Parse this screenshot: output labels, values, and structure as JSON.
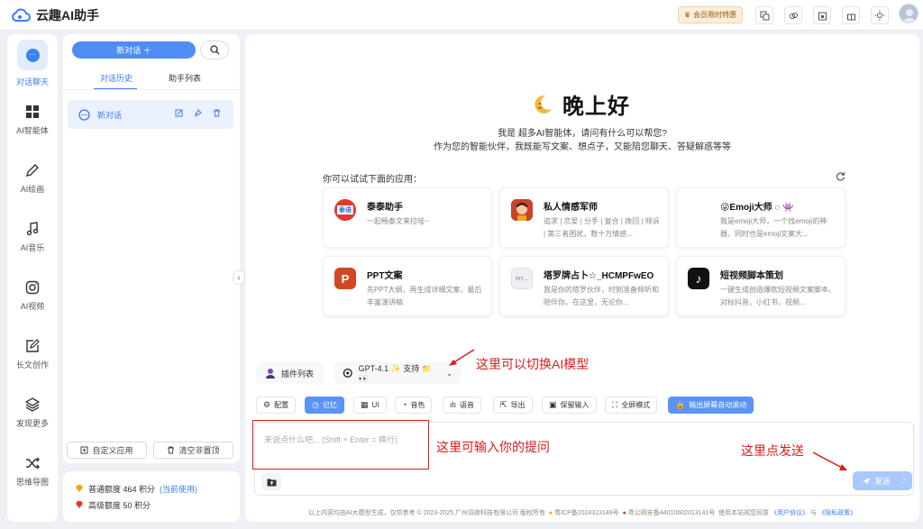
{
  "app": {
    "title": "云趣AI助手",
    "brand_color": "#3b7cf0"
  },
  "topbar": {
    "member_label": "会员限时特惠"
  },
  "rail": [
    {
      "label": "对话聊天"
    },
    {
      "label": "AI智能体"
    },
    {
      "label": "AI绘画"
    },
    {
      "label": "AI音乐"
    },
    {
      "label": "AI视频"
    },
    {
      "label": "长文创作"
    },
    {
      "label": "发现更多"
    },
    {
      "label": "思维导图"
    }
  ],
  "sidebar": {
    "new_chat": "新对话 ＋",
    "tabs": [
      "对话历史",
      "助手列表"
    ],
    "conversations": [
      {
        "title": "新对话"
      }
    ],
    "custom_app": "自定义应用",
    "clear": "清空非置顶"
  },
  "quota": {
    "normal": "普通额度 464 积分",
    "current": "(当前使用)",
    "advanced": "高级额度 50 积分"
  },
  "main": {
    "greeting": "晚上好",
    "intro1": "我是 超多AI智能体，请问有什么可以帮您?",
    "intro2": "作为您的智能伙伴，我既能写文案、想点子，又能陪您聊天、答疑解惑等等",
    "try_label": "你可以试试下面的应用：",
    "apps": [
      {
        "title": "泰泰助手",
        "desc": "一起畅泰文来拉哇~",
        "icon_text": "泰语"
      },
      {
        "title": "私人情感军师",
        "desc": "追求 | 恋爱 | 分手 | 复合 | 挽回 | 倾诉 | 第三者困扰，数十万情感...",
        "icon_text": ""
      },
      {
        "title": "😜Emoji大师 ◌ 👾",
        "desc": "我是emoji大师，一个找emoji的神器，同时也是emoji文案大...",
        "icon_text": "😎"
      },
      {
        "title": "PPT文案",
        "desc": "先PPT大纲，再生成详细文案，最后丰富演讲稿",
        "icon_text": "P"
      },
      {
        "title": "塔罗牌占卜☆_HCMPFwEO",
        "desc": "我是你的塔罗伙伴，时刻准备倾听和陪伴你。在这里，无论你...",
        "icon_text": "err..."
      },
      {
        "title": "短视频脚本策划",
        "desc": "一键生成创造爆款短视频文案脚本。对标抖音，小红书，视频...",
        "icon_text": "♪"
      }
    ],
    "plugin_label": "插件列表",
    "model_label": "GPT-4.1 ✨ 支持 📁 👀",
    "tools": [
      "配置",
      "记忆",
      "UI",
      "音色",
      "语音",
      "导出",
      "保留输入",
      "全屏模式",
      "输出屏幕自动滚动"
    ],
    "input_placeholder": "来说点什么吧... (Shift + Enter = 换行)",
    "send_label": "发送",
    "footer": {
      "text1": "以上内容均由AI大模型生成，仅供参考 © 2023-2025 广州羽夜科技有限公司 版权所有",
      "icp": "粤ICP备2024313148号",
      "gongan": "粤公网安备44010602013141号",
      "text2": "使用本站视您同意",
      "agreement": "《用户协议》",
      "and": "与",
      "privacy": "《隐私政策》"
    }
  },
  "annotations": {
    "model": "这里可以切换AI模型",
    "input": "这里可输入你的提问",
    "send": "这里点发送"
  }
}
